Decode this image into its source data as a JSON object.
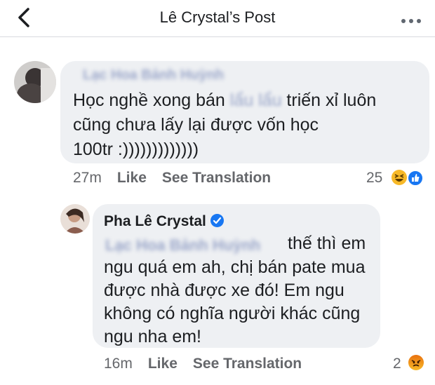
{
  "header": {
    "title": "Lê Crystal’s Post"
  },
  "comment1": {
    "author": "Lạc Hoa Bảnh Huỳnh",
    "blurred_word": "lẩu lẩu",
    "line1_a": "Học nghề xong bán",
    "line1_b": "triến xỉ luôn",
    "line2": "cũng chưa lấy lại được vốn học",
    "line3": "100tr  :)))))))))))))",
    "time": "27m",
    "like_label": "Like",
    "translate_label": "See Translation",
    "reaction_count": "25",
    "reactions": [
      "haha-emoji",
      "like-emoji"
    ]
  },
  "reply1": {
    "author": "Pha Lê Crystal",
    "mention": "Lạc Hoa Bảnh Huỳnh",
    "line1": "thế thì em",
    "line2": "ngu quá em ah, chị bán pate mua",
    "line3": "được nhà được xe đó! Em ngu",
    "line4": "không có nghĩa người khác cũng",
    "line5": "ngu nha em!",
    "time": "16m",
    "like_label": "Like",
    "translate_label": "See Translation",
    "reaction_count": "2",
    "reactions": [
      "angry-emoji"
    ]
  },
  "colors": {
    "bubble": "#eef0f3",
    "meta": "#65676b",
    "verified": "#1877f2"
  }
}
